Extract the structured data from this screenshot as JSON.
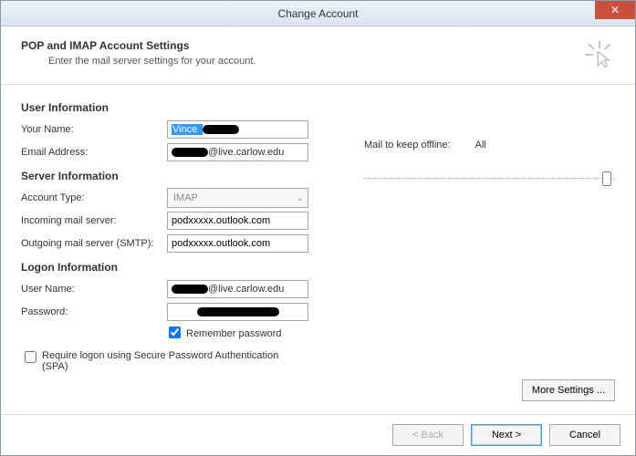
{
  "window": {
    "title": "Change Account"
  },
  "header": {
    "title": "POP and IMAP Account Settings",
    "subtitle": "Enter the mail server settings for your account."
  },
  "sections": {
    "user_info": "User Information",
    "server_info": "Server Information",
    "logon_info": "Logon Information"
  },
  "labels": {
    "your_name": "Your Name:",
    "email": "Email Address:",
    "account_type": "Account Type:",
    "incoming": "Incoming mail server:",
    "outgoing": "Outgoing mail server (SMTP):",
    "user_name": "User Name:",
    "password": "Password:",
    "remember": "Remember password",
    "spa": "Require logon using Secure Password Authentication (SPA)",
    "mail_keep": "Mail to keep offline:"
  },
  "values": {
    "your_name_visible": "Vince",
    "your_name_redacted_after": true,
    "email_domain": "@live.carlow.edu",
    "account_type": "IMAP",
    "incoming": "podxxxxx.outlook.com",
    "outgoing": "podxxxxx.outlook.com",
    "user_name_domain": "@live.carlow.edu",
    "password_masked": "••••••••••••",
    "remember_checked": true,
    "spa_checked": false,
    "mail_keep_value": "All"
  },
  "buttons": {
    "more_settings": "More Settings ...",
    "back": "< Back",
    "next": "Next >",
    "cancel": "Cancel"
  }
}
